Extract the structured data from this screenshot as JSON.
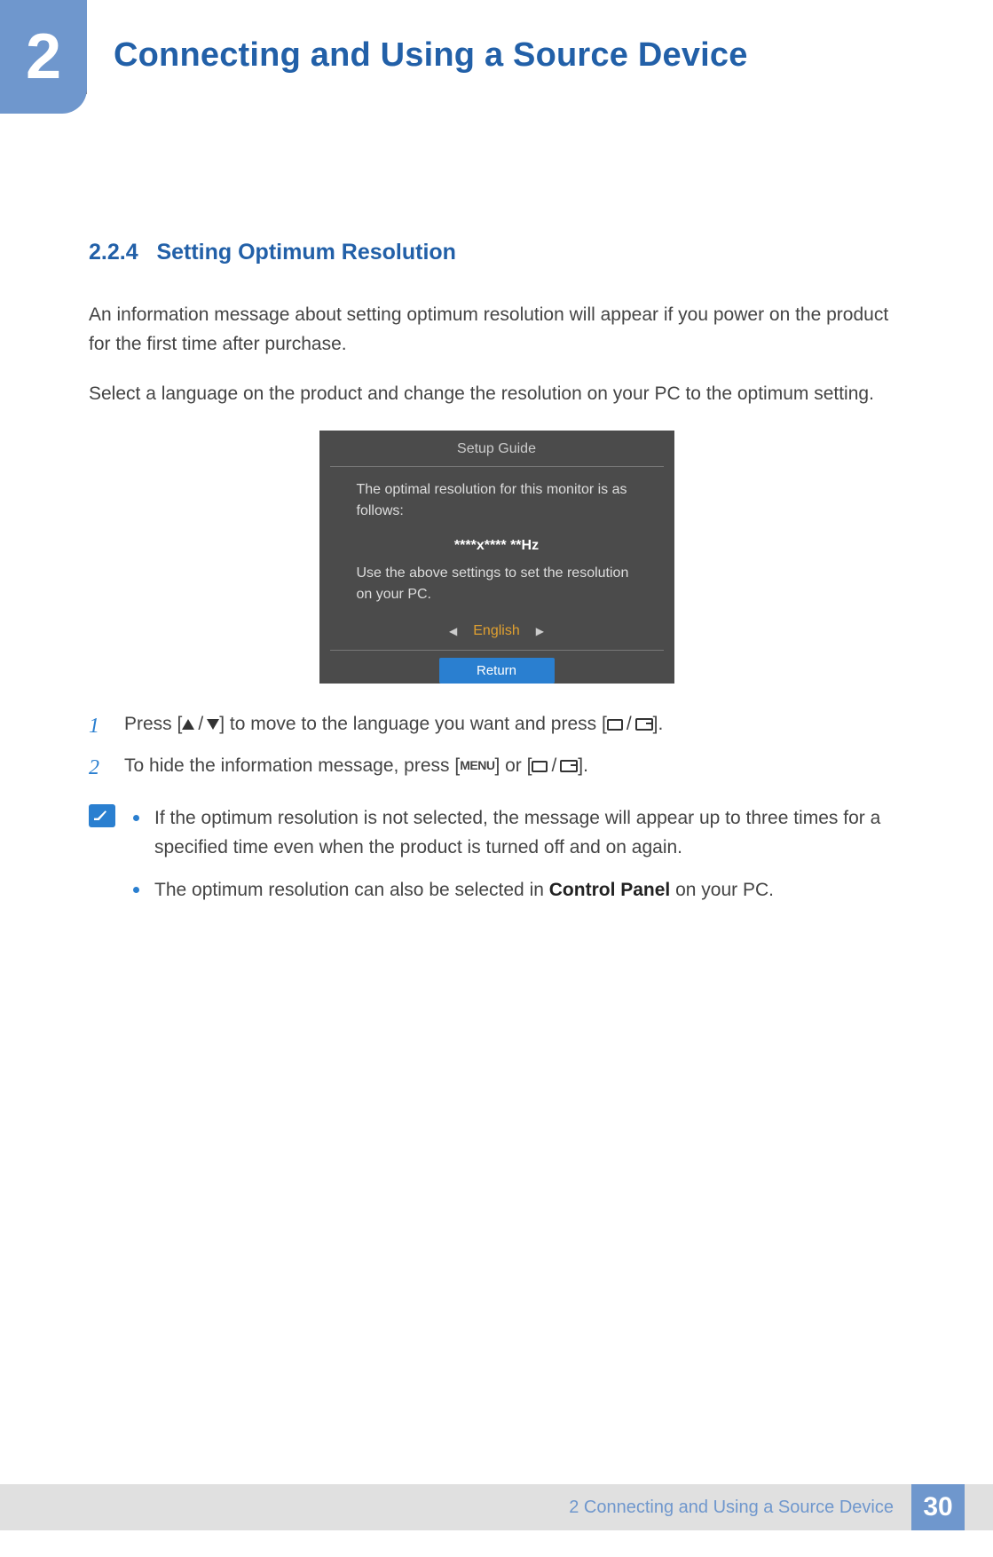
{
  "chapter": {
    "number": "2",
    "title": "Connecting and Using a Source Device"
  },
  "section": {
    "number": "2.2.4",
    "title": "Setting Optimum Resolution"
  },
  "paragraphs": {
    "p1": "An information message about setting optimum resolution will appear if you power on the product for the first time after purchase.",
    "p2": "Select a language on the product and change the resolution on your PC to the optimum setting."
  },
  "osd": {
    "title": "Setup Guide",
    "line1": "The optimal resolution for this monitor is as follows:",
    "resolution": "****x****  **Hz",
    "line2": "Use the above settings to set the resolution on your PC.",
    "language": "English",
    "return": "Return"
  },
  "steps": {
    "s1_a": "Press [",
    "s1_b": "] to move to the language you want and press [",
    "s1_c": "].",
    "s2_a": "To hide the information message, press [",
    "s2_b": "] or [",
    "s2_c": "].",
    "menu_label": "MENU"
  },
  "notes": {
    "n1": "If the optimum resolution is not selected, the message will appear up to three times for a specified time even when the product is turned off and on again.",
    "n2_a": "The optimum resolution can also be selected in ",
    "n2_bold": "Control Panel",
    "n2_b": " on your PC."
  },
  "footer": {
    "text": "2 Connecting and Using a Source Device",
    "page": "30"
  }
}
